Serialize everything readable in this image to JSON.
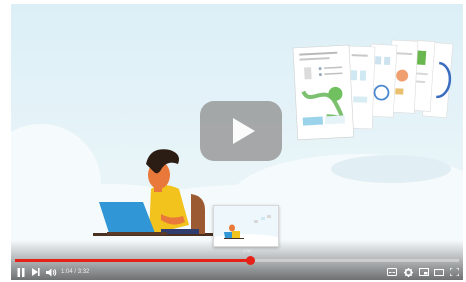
{
  "player": {
    "current_time": "1:04",
    "separator": "/",
    "duration": "3:32",
    "progress_fraction": 0.53,
    "preview_time": "1:04",
    "accent_color": "#e62117"
  },
  "icons": {
    "play": "play-icon",
    "pause": "pause-icon",
    "next": "next-icon",
    "volume": "volume-icon",
    "subtitles": "subtitles-icon",
    "settings": "gear-icon",
    "miniplayer": "miniplayer-icon",
    "theater": "theater-icon",
    "fullscreen": "fullscreen-icon"
  }
}
